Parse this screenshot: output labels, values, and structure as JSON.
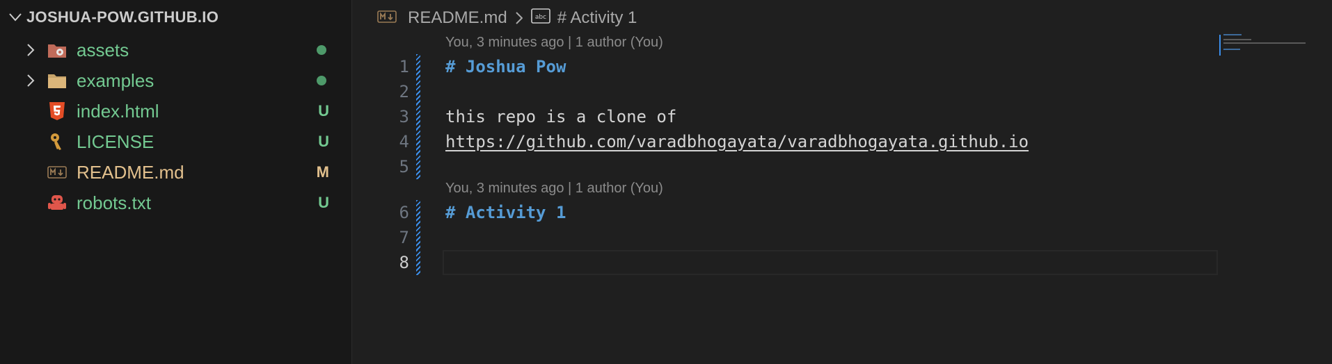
{
  "explorer": {
    "folder_name": "JOSHUA-POW.GITHUB.IO",
    "items": [
      {
        "name": "assets",
        "type": "folder",
        "icon": "assets-folder-icon",
        "status": "dot"
      },
      {
        "name": "examples",
        "type": "folder",
        "icon": "folder-icon",
        "status": "dot"
      },
      {
        "name": "index.html",
        "type": "file",
        "icon": "html5-icon",
        "status": "U"
      },
      {
        "name": "LICENSE",
        "type": "file",
        "icon": "license-key-icon",
        "status": "U"
      },
      {
        "name": "README.md",
        "type": "file",
        "icon": "markdown-icon",
        "status": "M"
      },
      {
        "name": "robots.txt",
        "type": "file",
        "icon": "robot-icon",
        "status": "U"
      }
    ]
  },
  "breadcrumb": {
    "file": "README.md",
    "symbol": "# Activity 1",
    "file_icon": "markdown-icon",
    "symbol_icon": "string-symbol-icon"
  },
  "editor": {
    "blame_1": "You, 3 minutes ago | 1 author (You)",
    "blame_2": "You, 3 minutes ago | 1 author (You)",
    "lines": [
      {
        "n": "1",
        "text": "# Joshua Pow"
      },
      {
        "n": "2",
        "text": ""
      },
      {
        "n": "3",
        "text": "this repo is a clone of"
      },
      {
        "n": "4",
        "text": "https://github.com/varadbhogayata/varadbhogayata.github.io"
      },
      {
        "n": "5",
        "text": ""
      },
      {
        "n": "6",
        "text": "# Activity 1"
      },
      {
        "n": "7",
        "text": ""
      },
      {
        "n": "8",
        "text": ""
      }
    ]
  },
  "colors": {
    "untracked": "#73c991",
    "modified": "#e2c08d",
    "heading": "#569cd6",
    "accent": "#3b8eea"
  }
}
